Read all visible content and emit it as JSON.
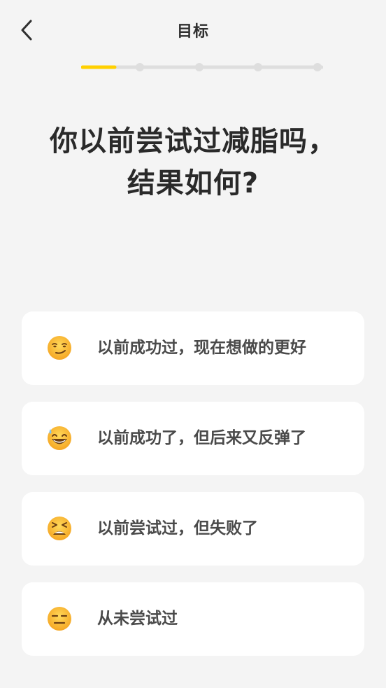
{
  "header": {
    "title": "目标",
    "back_icon": "chevron-left-icon"
  },
  "progress": {
    "current_step": 1,
    "total_steps": 5,
    "active_color": "#ffd000",
    "inactive_color": "#dedede"
  },
  "question": {
    "line1": "你以前尝试过减脂吗，",
    "line2": "结果如何?"
  },
  "options": [
    {
      "label": "以前成功过，现在想做的更好",
      "icon": "smirking-face-icon"
    },
    {
      "label": "以前成功了，但后来又反弹了",
      "icon": "grinning-face-with-sweat-icon"
    },
    {
      "label": "以前尝试过，但失败了",
      "icon": "tired-face-icon"
    },
    {
      "label": "从未尝试过",
      "icon": "expressionless-face-icon"
    }
  ]
}
